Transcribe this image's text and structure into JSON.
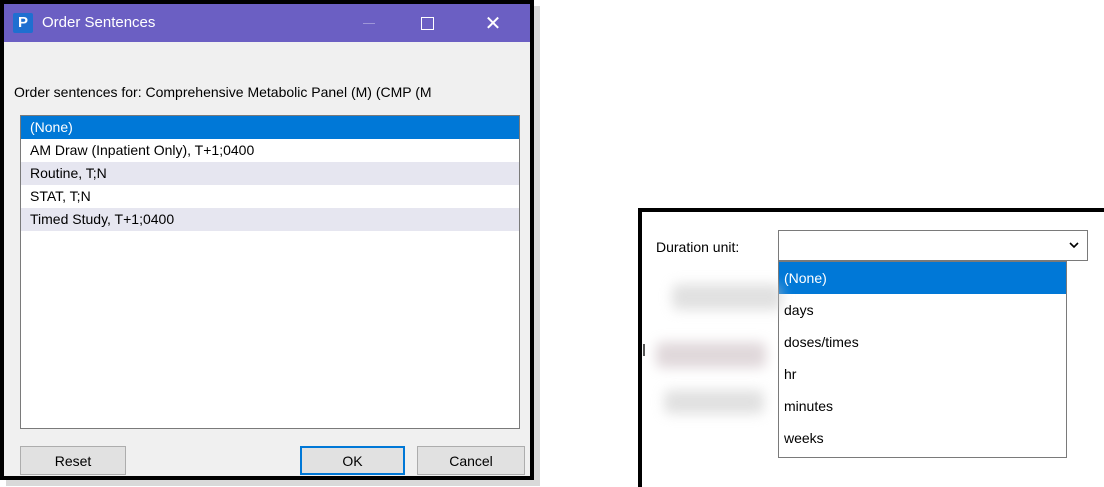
{
  "dialog": {
    "app_icon": "P",
    "title": "Order Sentences",
    "controls": {
      "minimize": "minimize-icon",
      "maximize": "maximize-icon",
      "close": "✕"
    },
    "subtitle": "Order sentences for: Comprehensive Metabolic Panel (M) (CMP (M",
    "sentences": [
      {
        "label": "(None)",
        "state": "selected"
      },
      {
        "label": "AM Draw (Inpatient Only), T+1;0400",
        "state": "normal"
      },
      {
        "label": "Routine, T;N",
        "state": "alt"
      },
      {
        "label": "STAT, T;N",
        "state": "normal"
      },
      {
        "label": "Timed Study, T+1;0400",
        "state": "alt"
      }
    ],
    "buttons": {
      "reset": "Reset",
      "ok": "OK",
      "cancel": "Cancel"
    }
  },
  "duration": {
    "label": "Duration unit:",
    "value": "",
    "arrow": "⌄",
    "options": [
      "(None)",
      "days",
      "doses/times",
      "hr",
      "minutes",
      "weeks"
    ],
    "selected": 0
  },
  "colors": {
    "titlebar": "#6b5fc3",
    "selection": "#0078d7",
    "alt_row": "#e6e6f0"
  }
}
